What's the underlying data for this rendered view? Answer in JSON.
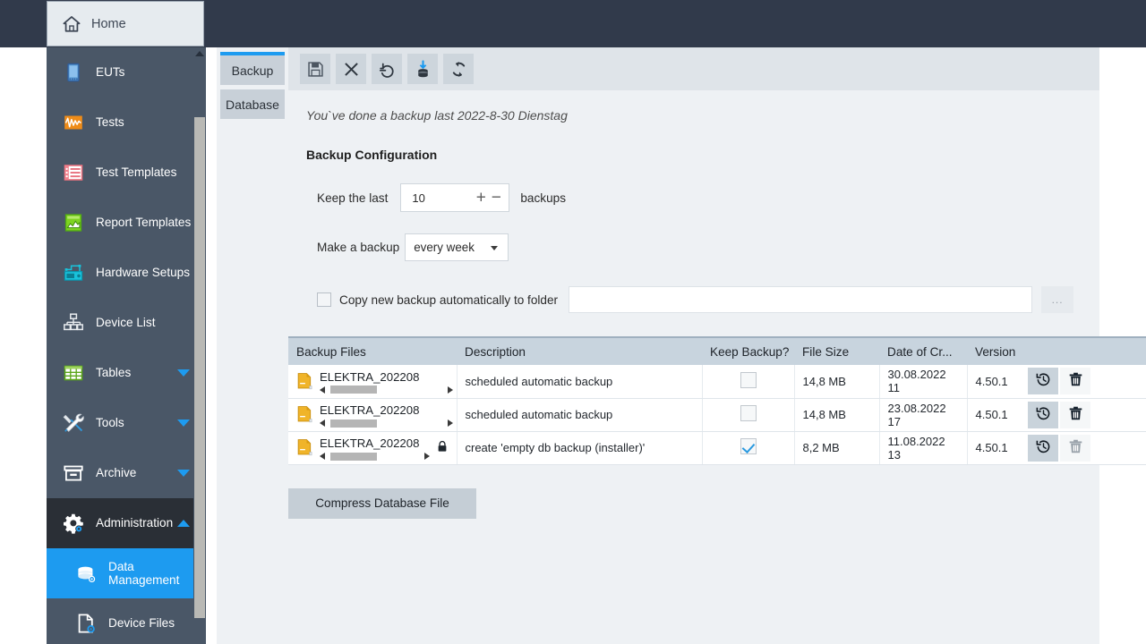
{
  "header": {
    "home_tab_label": "Home",
    "home_icon": "home-icon"
  },
  "sidebar": {
    "items": [
      {
        "label": "EUTs",
        "icon": "device-phone-icon",
        "state": "normal",
        "caret": "none"
      },
      {
        "label": "Tests",
        "icon": "waveform-icon",
        "state": "normal",
        "caret": "none"
      },
      {
        "label": "Test Templates",
        "icon": "list-template-icon",
        "state": "normal",
        "caret": "none"
      },
      {
        "label": "Report Templates",
        "icon": "report-chart-icon",
        "state": "normal",
        "caret": "none"
      },
      {
        "label": "Hardware Setups",
        "icon": "instrument-icon",
        "state": "normal",
        "caret": "none"
      },
      {
        "label": "Device List",
        "icon": "device-network-icon",
        "state": "normal",
        "caret": "none"
      },
      {
        "label": "Tables",
        "icon": "table-grid-icon",
        "state": "normal",
        "caret": "down"
      },
      {
        "label": "Tools",
        "icon": "tools-icon",
        "state": "normal",
        "caret": "down"
      },
      {
        "label": "Archive",
        "icon": "archive-box-icon",
        "state": "normal",
        "caret": "down"
      },
      {
        "label": "Administration",
        "icon": "gear-icon",
        "state": "group-open",
        "caret": "up"
      },
      {
        "label": "Data Management",
        "icon": "database-icon",
        "state": "selected",
        "caret": "none",
        "child": true
      },
      {
        "label": "Device Files",
        "icon": "file-device-icon",
        "state": "normal",
        "caret": "none",
        "child": true
      }
    ]
  },
  "tabs": [
    {
      "label": "Backup",
      "active": true
    },
    {
      "label": "Database",
      "active": false
    }
  ],
  "toolbar": {
    "buttons": [
      {
        "name": "save-icon",
        "title": "Save"
      },
      {
        "name": "cancel-icon",
        "title": "Cancel"
      },
      {
        "name": "undo-restore-icon",
        "title": "Undo"
      },
      {
        "name": "database-download-icon",
        "title": "Backup now"
      },
      {
        "name": "refresh-icon",
        "title": "Refresh"
      }
    ]
  },
  "main": {
    "status_line": "You`ve done a backup last 2022-8-30 Dienstag",
    "section_title": "Backup Configuration",
    "keep_last_label": "Keep the last",
    "keep_last_value": "10",
    "keep_last_suffix": "backups",
    "spin_plus": "+",
    "spin_minus": "−",
    "make_backup_label": "Make a backup",
    "make_backup_value": "every week",
    "copy_checkbox_label": "Copy new backup automatically to folder",
    "copy_path_value": "",
    "browse_label": "...",
    "compress_button_label": "Compress Database File"
  },
  "table": {
    "columns": [
      "Backup Files",
      "Description",
      "Keep Backup?",
      "File Size",
      "Date of Cr...",
      "Version",
      "",
      ""
    ],
    "rows": [
      {
        "file": "ELEKTRA_202208",
        "locked": false,
        "description": "scheduled automatic backup",
        "keep": false,
        "size": "14,8 MB",
        "date": "30.08.2022 11",
        "version": "4.50.1",
        "restore_icon": "restore-clock-icon",
        "delete_icon": "trash-icon",
        "delete_enabled": true
      },
      {
        "file": "ELEKTRA_202208",
        "locked": false,
        "description": "scheduled automatic backup",
        "keep": false,
        "size": "14,8 MB",
        "date": "23.08.2022 17",
        "version": "4.50.1",
        "restore_icon": "restore-clock-icon",
        "delete_icon": "trash-icon",
        "delete_enabled": true
      },
      {
        "file": "ELEKTRA_202208",
        "locked": true,
        "description": "create 'empty db backup (installer)'",
        "keep": true,
        "size": "8,2 MB",
        "date": "11.08.2022 13",
        "version": "4.50.1",
        "restore_icon": "restore-clock-icon",
        "delete_icon": "trash-icon",
        "delete_enabled": false
      }
    ]
  },
  "colors": {
    "accent": "#1d9bf0",
    "header_bar": "#313a4b",
    "sidebar": "#4a5767",
    "sidebar_group_open": "#2a2f36",
    "content_bg": "#eef1f4",
    "table_header": "#c8d4de"
  }
}
